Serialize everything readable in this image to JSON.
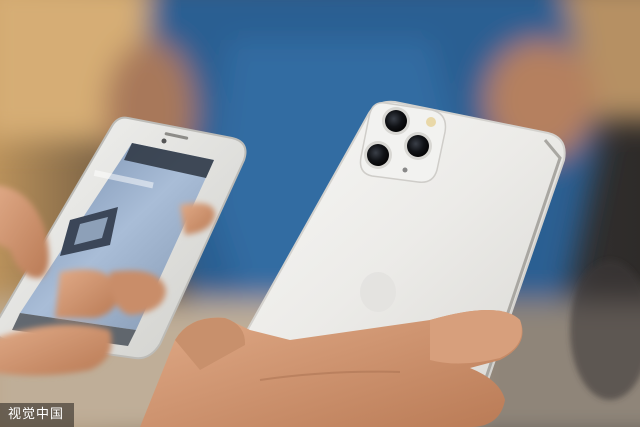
{
  "photo": {
    "subject": "photo",
    "colors": {
      "shirt_blue": "#2a5f92",
      "background_warm": "#c9a06a",
      "phone_white": "#eeeeec",
      "skin": "#d9a07d",
      "screen_blue": "#9fb6d4"
    }
  },
  "watermark": {
    "text": "视觉中国"
  }
}
